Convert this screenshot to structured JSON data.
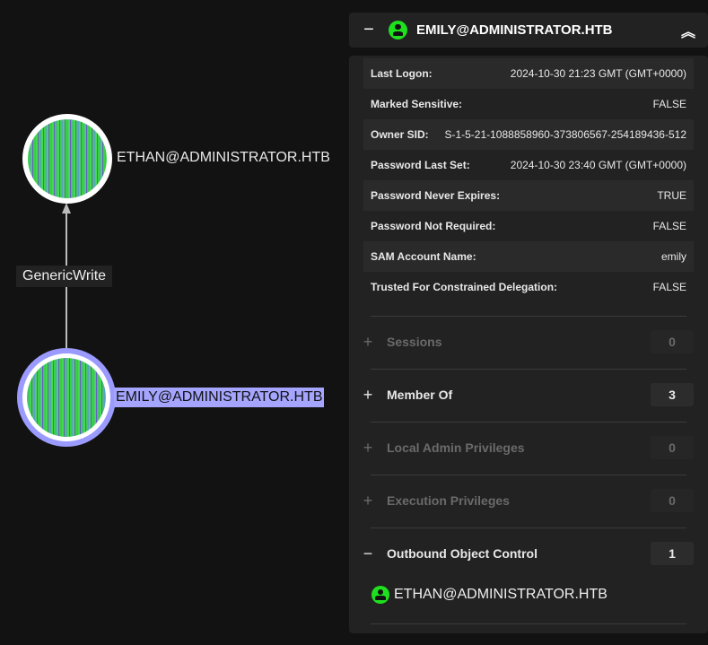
{
  "graph": {
    "nodes": [
      {
        "label": "ETHAN@ADMINISTRATOR.HTB"
      },
      {
        "label": "EMILY@ADMINISTRATOR.HTB",
        "selected": true
      }
    ],
    "edge": {
      "label": "GenericWrite"
    }
  },
  "panel": {
    "title": "EMILY@ADMINISTRATOR.HTB",
    "properties": [
      {
        "key": "Last Logon:",
        "value": "2024-10-30 21:23 GMT (GMT+0000)"
      },
      {
        "key": "Marked Sensitive:",
        "value": "FALSE"
      },
      {
        "key": "Owner SID:",
        "value": "S-1-5-21-1088858960-373806567-254189436-512"
      },
      {
        "key": "Password Last Set:",
        "value": "2024-10-30 23:40 GMT (GMT+0000)"
      },
      {
        "key": "Password Never Expires:",
        "value": "TRUE"
      },
      {
        "key": "Password Not Required:",
        "value": "FALSE"
      },
      {
        "key": "SAM Account Name:",
        "value": "emily"
      },
      {
        "key": "Trusted For Constrained Delegation:",
        "value": "FALSE"
      }
    ],
    "sections": [
      {
        "label": "Sessions",
        "count": "0",
        "sign": "+"
      },
      {
        "label": "Member Of",
        "count": "3",
        "sign": "+"
      },
      {
        "label": "Local Admin Privileges",
        "count": "0",
        "sign": "+"
      },
      {
        "label": "Execution Privileges",
        "count": "0",
        "sign": "+"
      },
      {
        "label": "Outbound Object Control",
        "count": "1",
        "sign": "−"
      }
    ],
    "outbound_item": "ETHAN@ADMINISTRATOR.HTB",
    "collapse_sign": "−",
    "collapse_all": "︽"
  }
}
